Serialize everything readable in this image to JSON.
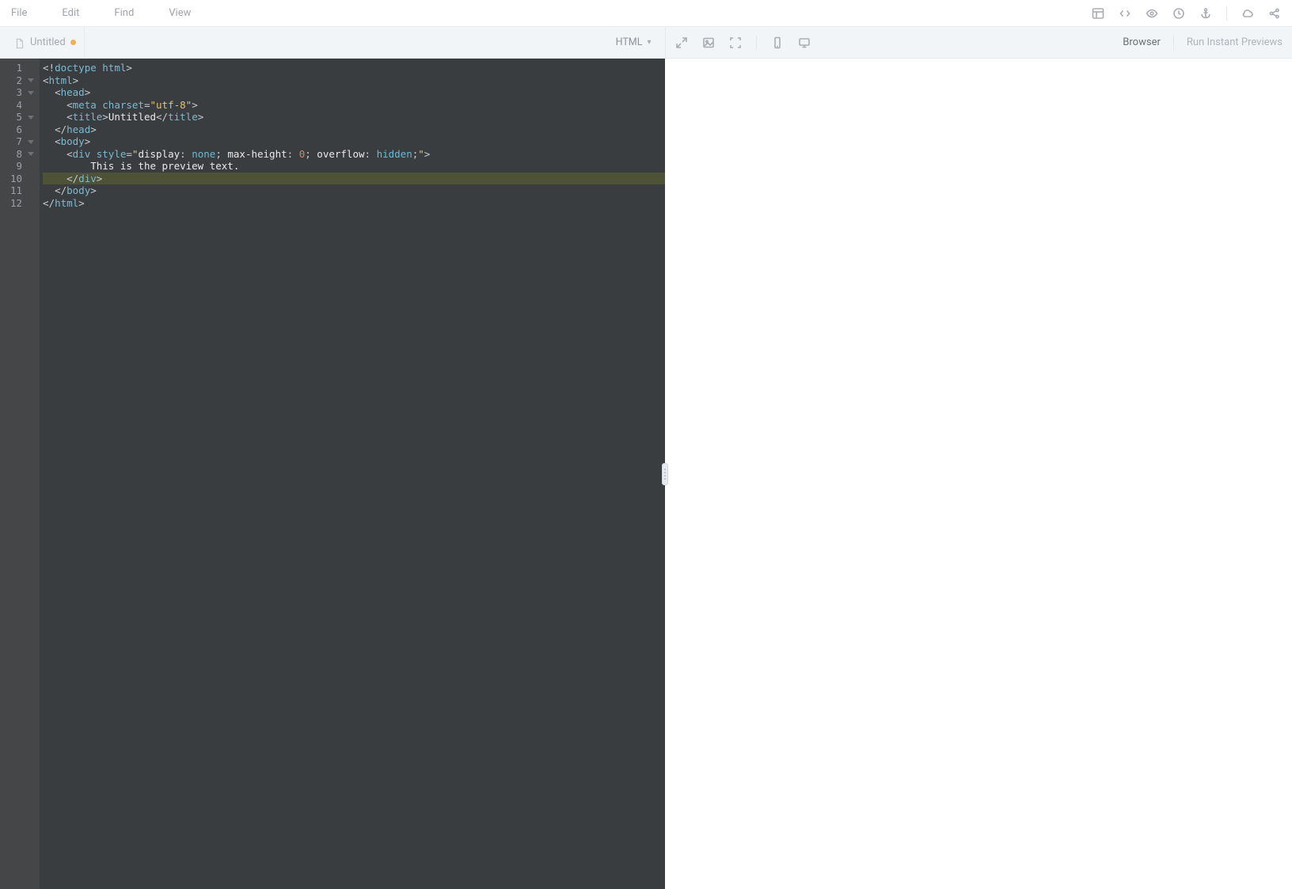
{
  "menubar": {
    "items": [
      "File",
      "Edit",
      "Find",
      "View"
    ]
  },
  "tab": {
    "title": "Untitled",
    "modified": true
  },
  "language_selector": {
    "label": "HTML"
  },
  "preview": {
    "browser_label": "Browser",
    "run_label": "Run Instant Previews"
  },
  "editor": {
    "highlighted_line": 10,
    "lines": [
      {
        "n": 1,
        "foldable": false
      },
      {
        "n": 2,
        "foldable": true
      },
      {
        "n": 3,
        "foldable": true
      },
      {
        "n": 4,
        "foldable": false
      },
      {
        "n": 5,
        "foldable": true
      },
      {
        "n": 6,
        "foldable": false
      },
      {
        "n": 7,
        "foldable": true
      },
      {
        "n": 8,
        "foldable": true
      },
      {
        "n": 9,
        "foldable": false
      },
      {
        "n": 10,
        "foldable": false
      },
      {
        "n": 11,
        "foldable": false
      },
      {
        "n": 12,
        "foldable": false
      }
    ],
    "code": {
      "l1": {
        "doctype": "<!doctype html>"
      },
      "l2": {
        "open": "html"
      },
      "l3": {
        "open": "head",
        "indent": 1
      },
      "l4": {
        "tag": "meta",
        "attr": "charset",
        "val": "\"utf-8\"",
        "indent": 2
      },
      "l5": {
        "open": "title",
        "text": "Untitled",
        "close": "title",
        "indent": 2
      },
      "l6": {
        "close": "head",
        "indent": 1
      },
      "l7": {
        "open": "body",
        "indent": 1
      },
      "l8": {
        "tag": "div",
        "attr": "style",
        "css_raw": "\"display: none; max-height: 0; overflow: hidden;\"",
        "indent": 2,
        "css_parts": [
          {
            "p": "display",
            "v": "none"
          },
          {
            "p": "max-height",
            "v": "0"
          },
          {
            "p": "overflow",
            "v": "hidden"
          }
        ]
      },
      "l9": {
        "text": "This is the preview text.",
        "indent": 4
      },
      "l10": {
        "close": "div",
        "indent": 2
      },
      "l11": {
        "close": "body",
        "indent": 1
      },
      "l12": {
        "close": "html",
        "indent": 0
      }
    }
  }
}
